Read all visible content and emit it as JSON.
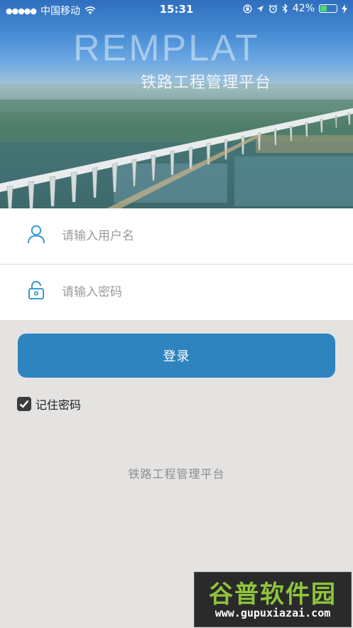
{
  "status_bar": {
    "signal_dots": "●●●●●",
    "carrier": "中国移动",
    "time": "15:31",
    "battery_percent": "42%",
    "battery_level": 0.42
  },
  "hero": {
    "brand": "REMPLAT",
    "subtitle": "铁路工程管理平台"
  },
  "form": {
    "username_placeholder": "请输入用户名",
    "password_placeholder": "请输入密码",
    "login_label": "登录",
    "remember_label": "记住密码",
    "remember_checked": true
  },
  "footer": {
    "platform_name": "铁路工程管理平台"
  },
  "watermark": {
    "title": "谷普软件园",
    "url": "www.gupuxiazai.com"
  },
  "colors": {
    "accent": "#2e84bf",
    "icon": "#3a9ad6",
    "background": "#e4e3e1"
  },
  "icons": [
    "wifi-icon",
    "rotation-lock-icon",
    "location-icon",
    "alarm-icon",
    "bluetooth-icon",
    "battery-icon",
    "user-icon",
    "lock-icon",
    "check-icon"
  ]
}
